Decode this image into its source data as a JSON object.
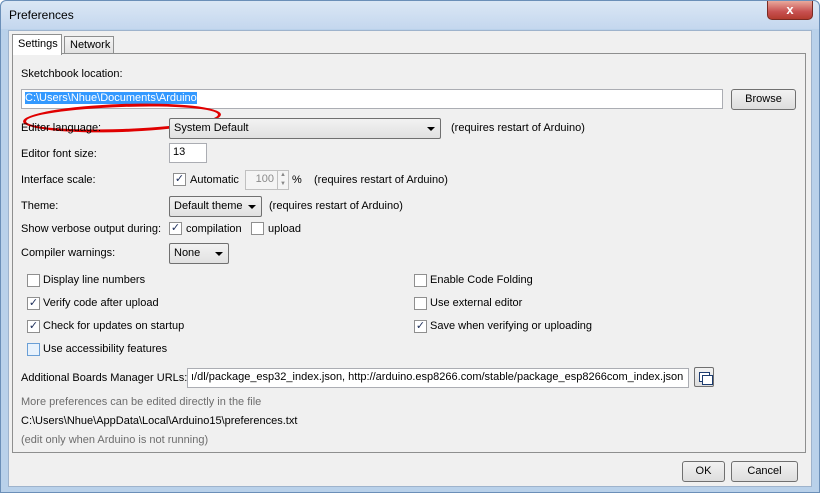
{
  "window": {
    "title": "Preferences",
    "close_glyph": "x"
  },
  "tabs": [
    {
      "label": "Settings"
    },
    {
      "label": "Network"
    }
  ],
  "sketchbook": {
    "label": "Sketchbook location:",
    "value": "C:\\Users\\Nhue\\Documents\\Arduino",
    "browse_label": "Browse"
  },
  "editor_language": {
    "label": "Editor language:",
    "selected": "System Default",
    "note": "(requires restart of Arduino)"
  },
  "editor_font_size": {
    "label": "Editor font size:",
    "value": "13"
  },
  "interface_scale": {
    "label": "Interface scale:",
    "automatic_label": "Automatic",
    "automatic_checked": true,
    "value": "100",
    "unit": "%",
    "note": "(requires restart of Arduino)"
  },
  "theme": {
    "label": "Theme:",
    "selected": "Default theme",
    "note": "(requires restart of Arduino)"
  },
  "verbose": {
    "label": "Show verbose output during:",
    "compilation_label": "compilation",
    "compilation_checked": true,
    "upload_label": "upload",
    "upload_checked": false
  },
  "compiler_warnings": {
    "label": "Compiler warnings:",
    "selected": "None"
  },
  "options_left": [
    {
      "label": "Display line numbers",
      "checked": false
    },
    {
      "label": "Verify code after upload",
      "checked": true
    },
    {
      "label": "Check for updates on startup",
      "checked": true
    },
    {
      "label": "Use accessibility features",
      "checked": false
    }
  ],
  "options_right": [
    {
      "label": "Enable Code Folding",
      "checked": false
    },
    {
      "label": "Use external editor",
      "checked": false
    },
    {
      "label": "Save when verifying or uploading",
      "checked": true
    }
  ],
  "boards_manager": {
    "label": "Additional Boards Manager URLs:",
    "value": "ı/dl/package_esp32_index.json, http://arduino.esp8266.com/stable/package_esp8266com_index.json"
  },
  "footer_notes": {
    "more_prefs": "More preferences can be edited directly in the file",
    "prefs_path": "C:\\Users\\Nhue\\AppData\\Local\\Arduino15\\preferences.txt",
    "edit_note": "(edit only when Arduino is not running)"
  },
  "buttons": {
    "ok": "OK",
    "cancel": "Cancel"
  },
  "colors": {
    "selection": "#3399ff",
    "annotation": "#e00000",
    "title_bar": "#c4d7ee"
  },
  "check_glyph": "✓"
}
